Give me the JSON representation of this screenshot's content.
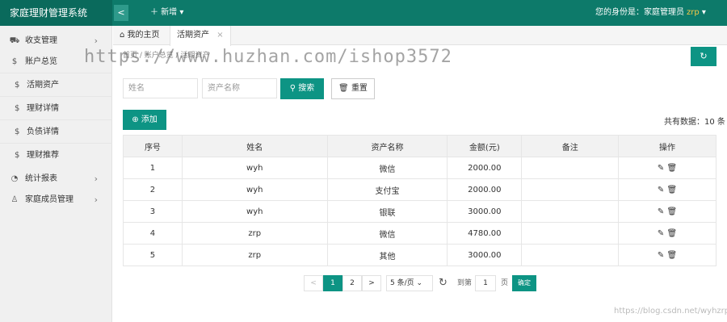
{
  "app": {
    "title": "家庭理财管理系统",
    "collapse_icon": "<",
    "new_label": "＋ 新增",
    "identity_label": "您的身份是：家庭管理员",
    "user": "zrp"
  },
  "sidebar": {
    "menus": [
      {
        "label": "收支管理",
        "icon": "cart-icon"
      },
      {
        "label": "账户总览",
        "icon": "dollar-icon"
      },
      {
        "label": "统计报表",
        "icon": "chart-icon"
      },
      {
        "label": "家庭成员管理",
        "icon": "user-icon"
      }
    ],
    "sub_items": [
      {
        "label": "活期资产"
      },
      {
        "label": "理财详情"
      },
      {
        "label": "负债详情"
      },
      {
        "label": "理财推荐"
      }
    ]
  },
  "tabs": {
    "home": "我的主页",
    "active": "活期资产"
  },
  "breadcrumb": "首页 / 账户总览 / 活期资产",
  "watermark": "https://www.huzhan.com/ishop3572",
  "search": {
    "name_placeholder": "姓名",
    "asset_placeholder": "资产名称",
    "search_label": "搜索",
    "reset_label": "重置"
  },
  "add_label": "添加",
  "total_label": "共有数据：10 条",
  "table": {
    "headers": [
      "序号",
      "姓名",
      "资产名称",
      "金额(元)",
      "备注",
      "操作"
    ],
    "rows": [
      [
        "1",
        "wyh",
        "微信",
        "2000.00",
        ""
      ],
      [
        "2",
        "wyh",
        "支付宝",
        "2000.00",
        ""
      ],
      [
        "3",
        "wyh",
        "银联",
        "3000.00",
        ""
      ],
      [
        "4",
        "zrp",
        "微信",
        "4780.00",
        ""
      ],
      [
        "5",
        "zrp",
        "其他",
        "3000.00",
        ""
      ]
    ]
  },
  "pagination": {
    "prev": "<",
    "pages": [
      "1",
      "2"
    ],
    "next": ">",
    "page_size": "5 条/页",
    "goto_label": "到第",
    "goto_value": "1",
    "page_unit": "页",
    "confirm": "确定"
  },
  "credit": "https://blog.csdn.net/wyhzrp"
}
